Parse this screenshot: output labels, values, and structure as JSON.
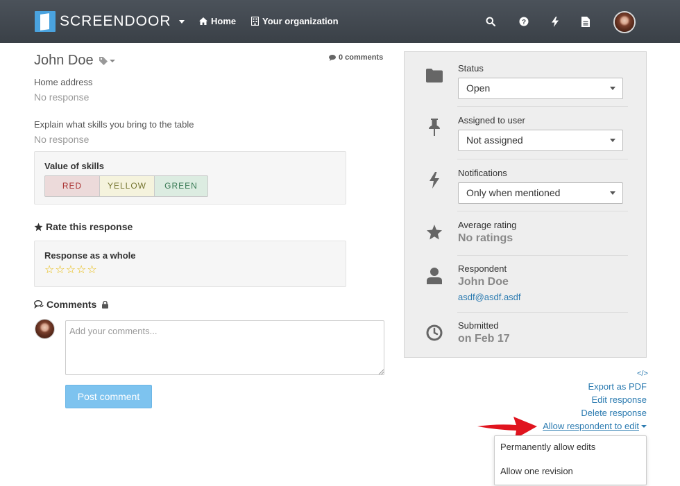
{
  "navbar": {
    "brand": "SCREENDOOR",
    "links": [
      {
        "label": "Home",
        "icon": "home-icon"
      },
      {
        "label": "Your organization",
        "icon": "building-icon"
      }
    ],
    "icons": [
      "search-icon",
      "help-icon",
      "bolt-icon",
      "document-icon"
    ]
  },
  "response": {
    "name": "John Doe",
    "comments_count": "0 comments",
    "fields": [
      {
        "label": "Home address",
        "value": "No response"
      },
      {
        "label": "Explain what skills you bring to the table",
        "value": "No response"
      }
    ],
    "skills": {
      "label": "Value of skills",
      "options": [
        "RED",
        "YELLOW",
        "GREEN"
      ]
    }
  },
  "rating": {
    "title": "Rate this response",
    "box_label": "Response as a whole",
    "stars": 0,
    "max_stars": 5
  },
  "comments": {
    "title": "Comments",
    "placeholder": "Add your comments...",
    "post_label": "Post comment"
  },
  "panel": {
    "status": {
      "label": "Status",
      "value": "Open"
    },
    "assigned": {
      "label": "Assigned to user",
      "value": "Not assigned"
    },
    "notifications": {
      "label": "Notifications",
      "value": "Only when mentioned"
    },
    "rating": {
      "label": "Average rating",
      "value": "No ratings"
    },
    "respondent": {
      "label": "Respondent",
      "name": "John Doe",
      "email": "asdf@asdf.asdf"
    },
    "submitted": {
      "label": "Submitted",
      "value": "on Feb 17"
    }
  },
  "actions": {
    "embed": "</>",
    "export": "Export as PDF",
    "edit": "Edit response",
    "delete": "Delete response",
    "allow_edit": "Allow respondent to edit"
  },
  "dropdown": {
    "items": [
      "Permanently allow edits",
      "Allow one revision"
    ]
  },
  "colors": {
    "navbar": "#41474e",
    "brand_accent": "#4aa3df",
    "link": "#2a7ab0",
    "post_button": "#7dc3ef",
    "star": "#e6b800",
    "annotation_arrow": "#e0141e"
  }
}
